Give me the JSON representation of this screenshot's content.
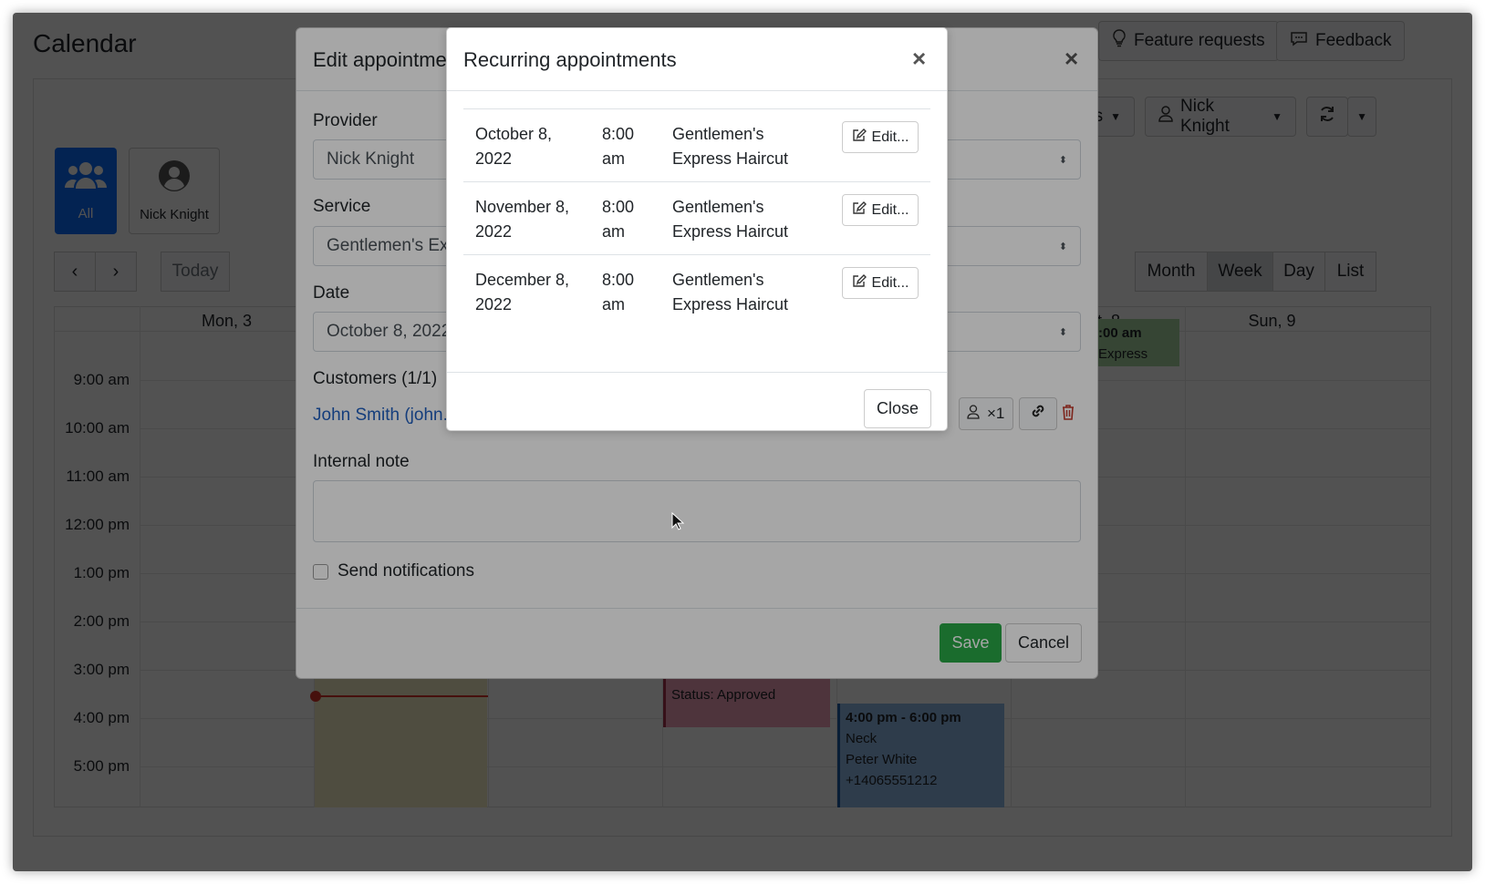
{
  "calendar": {
    "title": "Calendar",
    "top_buttons": {
      "feature_requests": "Feature requests",
      "feedback": "Feedback"
    },
    "providers": {
      "all": "All",
      "nick": "Nick Knight"
    },
    "nav": {
      "today": "Today"
    },
    "views": [
      "Month",
      "Week",
      "Day",
      "List"
    ],
    "active_view": "Week",
    "toolbar_provider": "Nick Knight",
    "toolbar_partial": "s",
    "days": {
      "mon": "Mon, 3",
      "sat_partial": "t, 8",
      "sun": "Sun, 9"
    },
    "times": [
      "9:00 am",
      "10:00 am",
      "11:00 am",
      "12:00 pm",
      "1:00 pm",
      "2:00 pm",
      "3:00 pm",
      "4:00 pm",
      "5:00 pm"
    ],
    "events": {
      "green": {
        "time": ":00 am",
        "title": "Express"
      },
      "pink": {
        "status": "Status: Approved"
      },
      "blue": {
        "time": "4:00 pm - 6:00 pm",
        "title": "Neck",
        "customer": "Peter White",
        "phone": "+14065551212"
      }
    },
    "colors": {
      "primary": "#0d6efd",
      "green_event": "#a7d7a0",
      "pink_event": "#f3a3b8",
      "blue_event": "#8fb8e6",
      "yellow_event": "#f5efc6",
      "now_line": "#d9342b"
    }
  },
  "edit_appointment": {
    "title_partial": "Edit appointme",
    "provider_label": "Provider",
    "provider_value": "Nick Knight",
    "service_label": "Service",
    "service_value": "Gentlemen's Exp",
    "date_label": "Date",
    "date_value": "October 8, 2022",
    "customers_label": "Customers (1/1)",
    "customer_link": "John Smith (john.s",
    "customer_count": "×1",
    "internal_note_label": "Internal note",
    "send_notifications": "Send notifications",
    "save": "Save",
    "cancel": "Cancel",
    "save_color": "#28a745"
  },
  "recurring": {
    "title": "Recurring appointments",
    "rows": [
      {
        "date_line1": "October 8,",
        "date_line2": "2022",
        "time_line1": "8:00",
        "time_line2": "am",
        "service_line1": "Gentlemen's",
        "service_line2": "Express Haircut",
        "edit": "Edit..."
      },
      {
        "date_line1": "November 8,",
        "date_line2": "2022",
        "time_line1": "8:00",
        "time_line2": "am",
        "service_line1": "Gentlemen's",
        "service_line2": "Express Haircut",
        "edit": "Edit..."
      },
      {
        "date_line1": "December 8,",
        "date_line2": "2022",
        "time_line1": "8:00",
        "time_line2": "am",
        "service_line1": "Gentlemen's",
        "service_line2": "Express Haircut",
        "edit": "Edit..."
      }
    ],
    "close": "Close"
  }
}
